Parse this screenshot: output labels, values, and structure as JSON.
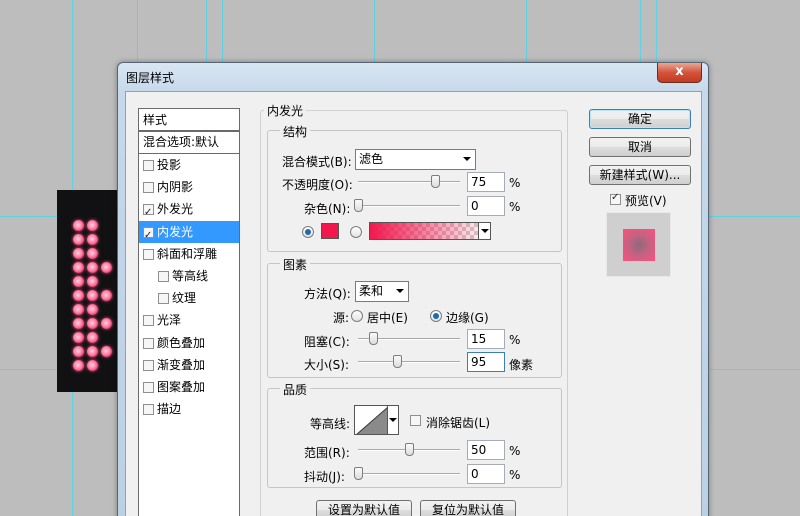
{
  "dialog": {
    "title": "图层样式",
    "close_glyph": "x"
  },
  "styles_panel": {
    "header": "样式",
    "blend_options": "混合选项:默认",
    "items": [
      {
        "label": "投影",
        "checked": false,
        "selected": false,
        "sub": false
      },
      {
        "label": "内阴影",
        "checked": false,
        "selected": false,
        "sub": false
      },
      {
        "label": "外发光",
        "checked": true,
        "selected": false,
        "sub": false
      },
      {
        "label": "内发光",
        "checked": true,
        "selected": true,
        "sub": false
      },
      {
        "label": "斜面和浮雕",
        "checked": false,
        "selected": false,
        "sub": false
      },
      {
        "label": "等高线",
        "checked": false,
        "selected": false,
        "sub": true
      },
      {
        "label": "纹理",
        "checked": false,
        "selected": false,
        "sub": true
      },
      {
        "label": "光泽",
        "checked": false,
        "selected": false,
        "sub": false
      },
      {
        "label": "颜色叠加",
        "checked": false,
        "selected": false,
        "sub": false
      },
      {
        "label": "渐变叠加",
        "checked": false,
        "selected": false,
        "sub": false
      },
      {
        "label": "图案叠加",
        "checked": false,
        "selected": false,
        "sub": false
      },
      {
        "label": "描边",
        "checked": false,
        "selected": false,
        "sub": false
      }
    ]
  },
  "inner_glow": {
    "title": "内发光",
    "structure": {
      "title": "结构",
      "blend_mode_label": "混合模式(B):",
      "blend_mode_value": "滤色",
      "opacity_label": "不透明度(O):",
      "opacity_value": "75",
      "opacity_unit": "%",
      "opacity_fraction": 0.75,
      "noise_label": "杂色(N):",
      "noise_value": "0",
      "noise_unit": "%",
      "noise_fraction": 0.0,
      "glow_color": "#f2184e",
      "color_mode": "solid"
    },
    "elements": {
      "title": "图素",
      "technique_label": "方法(Q):",
      "technique_value": "柔和",
      "source_label": "源:",
      "source_center_label": "居中(E)",
      "source_edge_label": "边缘(G)",
      "source_selected": "edge",
      "choke_label": "阻塞(C):",
      "choke_value": "15",
      "choke_unit": "%",
      "choke_fraction": 0.15,
      "size_label": "大小(S):",
      "size_value": "95",
      "size_unit": "像素",
      "size_fraction": 0.38
    },
    "quality": {
      "title": "品质",
      "contour_label": "等高线:",
      "anti_alias_label": "消除锯齿(L)",
      "anti_alias_checked": false,
      "range_label": "范围(R):",
      "range_value": "50",
      "range_unit": "%",
      "range_fraction": 0.5,
      "jitter_label": "抖动(J):",
      "jitter_value": "0",
      "jitter_unit": "%",
      "jitter_fraction": 0.0
    },
    "make_default_label": "设置为默认值",
    "reset_default_label": "复位为默认值"
  },
  "buttons": {
    "ok": "确定",
    "cancel": "取消",
    "new_style": "新建样式(W)...",
    "preview_label": "预览(V)",
    "preview_checked": true
  }
}
